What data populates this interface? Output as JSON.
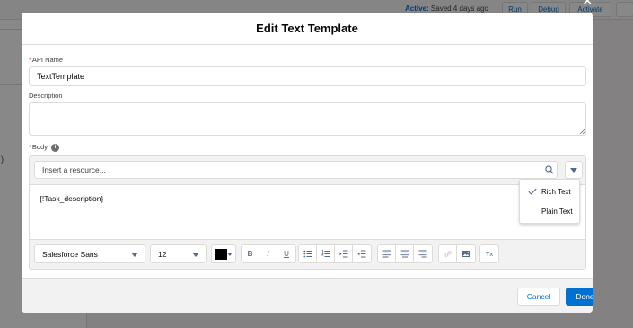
{
  "background": {
    "status_prefix": "Active:",
    "status_text": " Saved 4 days ago",
    "run_label": "Run",
    "debug_label": "Debug",
    "activate_label": "Activate",
    "paren": ")"
  },
  "modal": {
    "title": "Edit Text Template",
    "api_name": {
      "label": "API Name",
      "required_mark": "*",
      "value": "TextTemplate"
    },
    "description": {
      "label": "Description",
      "value": ""
    },
    "body": {
      "label": "Body",
      "required_mark": "*",
      "info_icon": "info-icon",
      "resource_placeholder": "Insert a resource...",
      "content": "{!Task_description}",
      "format_menu": {
        "selected": "Rich Text",
        "options": [
          "Rich Text",
          "Plain Text"
        ]
      },
      "toolbar": {
        "font_family": "Salesforce Sans",
        "font_size": "12",
        "text_color": "#000000",
        "bold": "B",
        "italic": "I",
        "underline": "U",
        "clear_format": "Tx"
      }
    },
    "footer": {
      "cancel_label": "Cancel",
      "done_label": "Done"
    }
  },
  "colors": {
    "brand": "#0070d2",
    "required": "#c23934",
    "border": "#dddbda"
  }
}
